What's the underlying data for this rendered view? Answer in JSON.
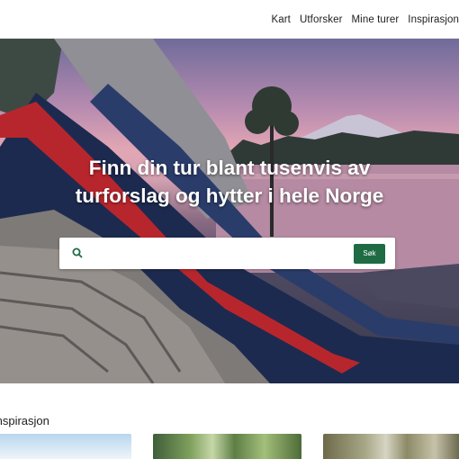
{
  "nav": {
    "items": [
      {
        "label": "Kart"
      },
      {
        "label": "Utforsker"
      },
      {
        "label": "Mine turer"
      },
      {
        "label": "Inspirasjon"
      }
    ]
  },
  "hero": {
    "headline_line1": "Finn din tur blant tusenvis av",
    "headline_line2": "turforslag og hytter i hele Norge",
    "search": {
      "placeholder": "",
      "button_label": "Søk",
      "button_color": "#1f6b43"
    }
  },
  "inspiration": {
    "title": "Inspirasjon"
  }
}
